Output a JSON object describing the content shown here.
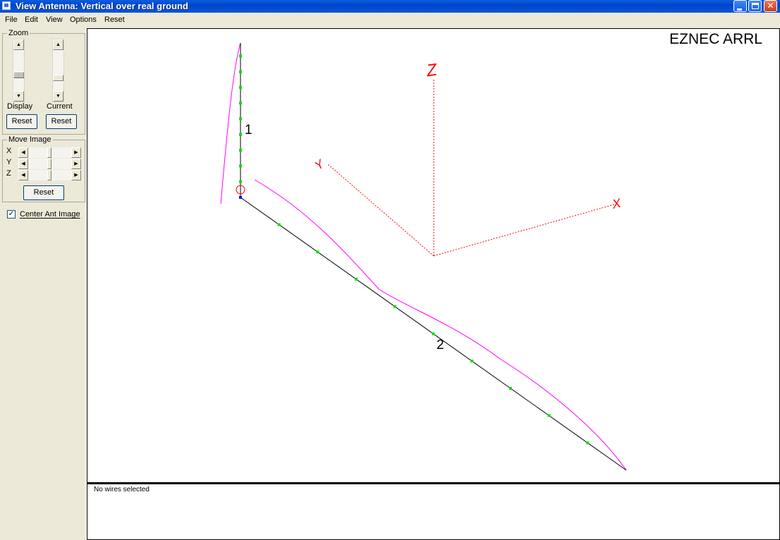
{
  "window": {
    "title": "View Antenna: Vertical over real ground",
    "minimize_glyph": "_",
    "maximize_glyph": "□",
    "close_glyph": "✕"
  },
  "menu": [
    "File",
    "Edit",
    "View",
    "Options",
    "Reset"
  ],
  "left_panel": {
    "zoom": {
      "legend": "Zoom",
      "display_label": "Display",
      "current_label": "Current",
      "reset_display": "Reset",
      "reset_current": "Reset"
    },
    "move_image": {
      "legend": "Move Image",
      "axes": [
        "X",
        "Y",
        "Z"
      ],
      "reset": "Reset"
    },
    "center_ant_image": {
      "label": "Center Ant Image",
      "checked": true,
      "check_glyph": "✓"
    },
    "arrow_glyphs": {
      "up": "▲",
      "down": "▼",
      "left": "◀",
      "right": "▶"
    }
  },
  "canvas": {
    "brand": "EZNEC ARRL",
    "wire_labels": [
      "1",
      "2"
    ],
    "axis_labels": [
      "Z",
      "Y",
      "X"
    ],
    "colors": {
      "wire": "#000000",
      "segment": "#00e000",
      "current": "#ff00ff",
      "axes": "#ff0000",
      "source": "#ff0000",
      "ground_point": "#0000ff"
    }
  },
  "status": {
    "text": "No wires selected"
  }
}
